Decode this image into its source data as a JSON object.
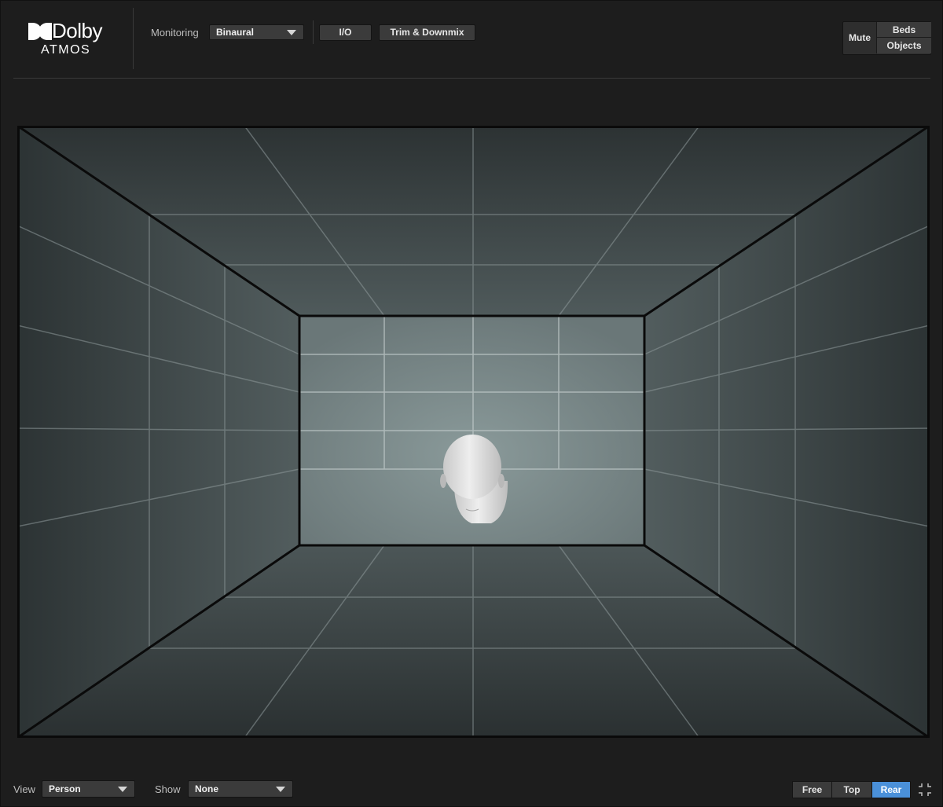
{
  "brand": {
    "name": "Dolby",
    "product": "ATMOS",
    "logo_icon": "dolby-double-d-icon"
  },
  "header": {
    "monitoring_label": "Monitoring",
    "monitoring_value": "Binaural",
    "io_button": "I/O",
    "trim_button": "Trim & Downmix",
    "mute_label": "Mute",
    "beds_button": "Beds",
    "objects_button": "Objects"
  },
  "viewport": {
    "room_view": "rear",
    "listener_icon": "head-icon",
    "colors": {
      "room_wall": "#3a4143",
      "back_wall": "#6f7f80",
      "grid_line": "#8a9496",
      "edge_line": "#0a0a0a"
    }
  },
  "footer": {
    "view_label": "View",
    "view_value": "Person",
    "show_label": "Show",
    "show_value": "None",
    "camera_buttons": [
      {
        "label": "Free",
        "active": false
      },
      {
        "label": "Top",
        "active": false
      },
      {
        "label": "Rear",
        "active": true
      }
    ],
    "collapse_icon": "collapse-icon",
    "accent_color": "#4a90d9"
  }
}
